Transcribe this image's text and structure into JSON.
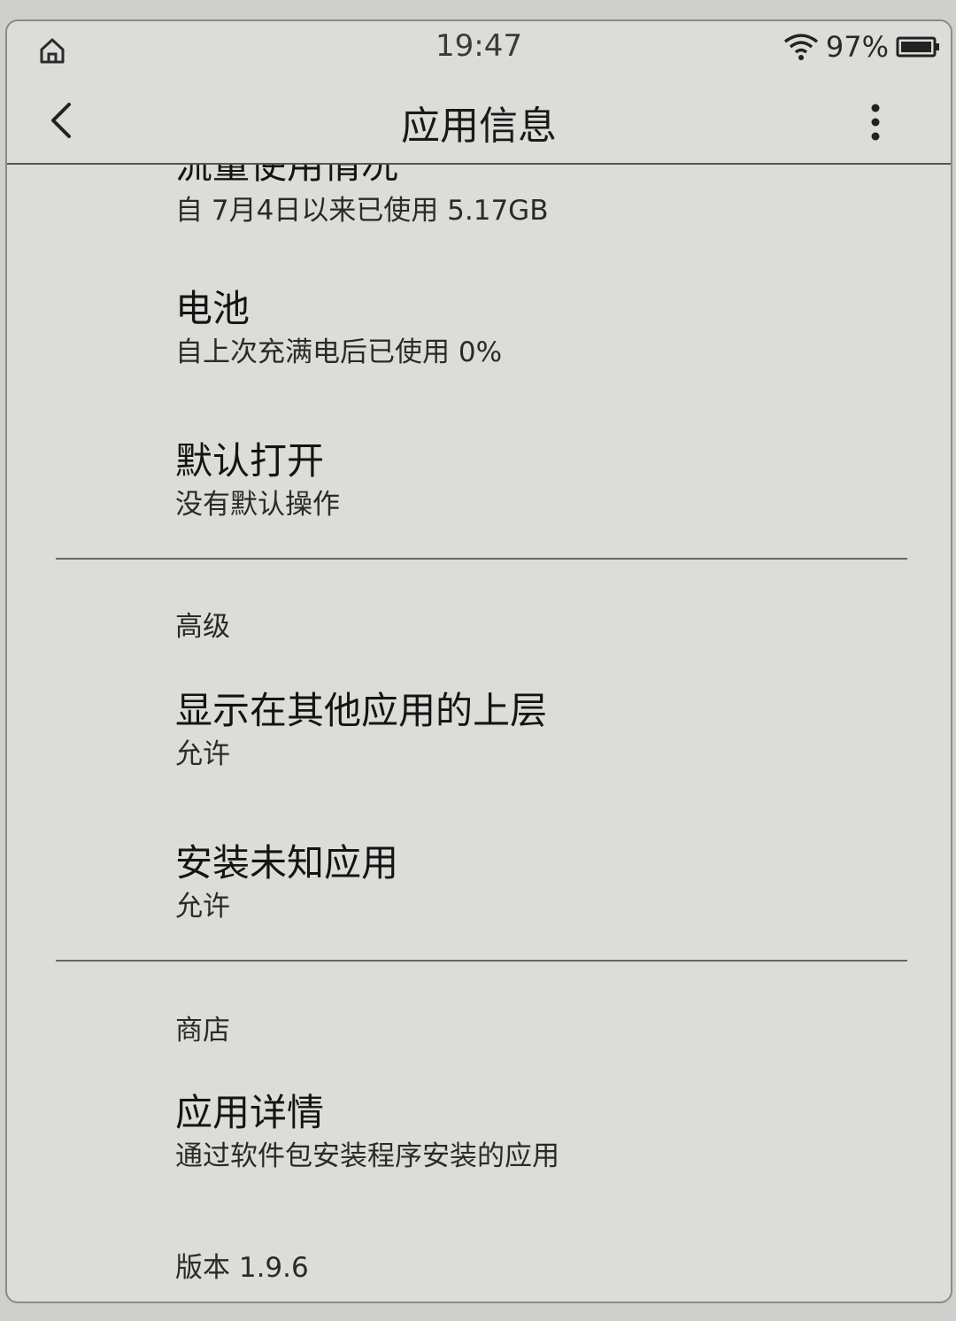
{
  "status": {
    "time": "19:47",
    "battery_percent": "97%",
    "icons": [
      "home-icon",
      "wifi-icon",
      "battery-icon"
    ]
  },
  "toolbar": {
    "title": "应用信息",
    "back_icon": "chevron-left-icon",
    "more_icon": "more-vert-icon"
  },
  "items": {
    "data_usage": {
      "title": "流量使用情况",
      "subtitle": "自 7月4日以来已使用 5.17GB"
    },
    "battery": {
      "title": "电池",
      "subtitle": "自上次充满电后已使用 0%"
    },
    "open_by_default": {
      "title": "默认打开",
      "subtitle": "没有默认操作"
    }
  },
  "advanced": {
    "header": "高级",
    "display_over": {
      "title": "显示在其他应用的上层",
      "subtitle": "允许"
    },
    "install_unknown": {
      "title": "安装未知应用",
      "subtitle": "允许"
    }
  },
  "store": {
    "header": "商店",
    "app_details": {
      "title": "应用详情",
      "subtitle": "通过软件包安装程序安装的应用"
    },
    "version": "版本 1.9.6"
  }
}
